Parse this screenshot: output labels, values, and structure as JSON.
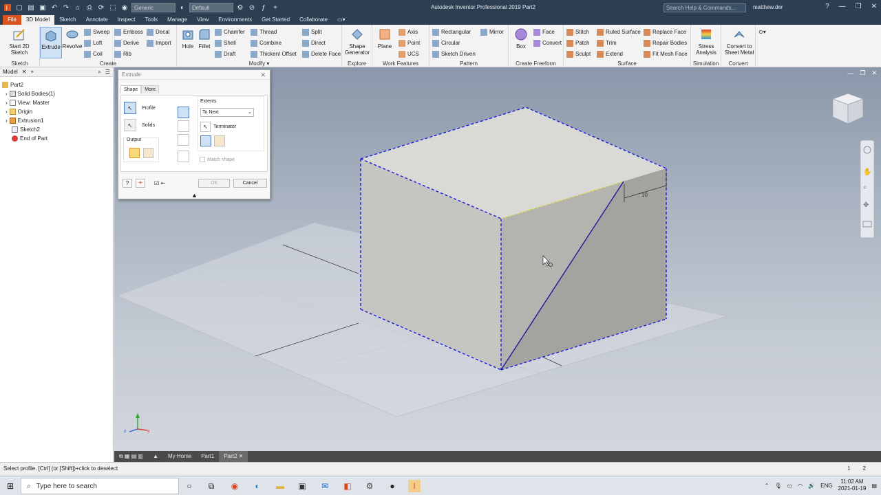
{
  "titlebar": {
    "app_title": "Autodesk Inventor Professional 2019    Part2",
    "material": "Generic",
    "appearance": "Default",
    "search_placeholder": "Search Help & Commands...",
    "user": "matthew.der"
  },
  "ribbon_tabs": [
    "File",
    "3D Model",
    "Sketch",
    "Annotate",
    "Inspect",
    "Tools",
    "Manage",
    "View",
    "Environments",
    "Get Started",
    "Collaborate"
  ],
  "ribbon": {
    "sketch": {
      "title": "Sketch",
      "start_sketch": "Start 2D Sketch"
    },
    "create": {
      "title": "Create",
      "extrude": "Extrude",
      "revolve": "Revolve",
      "sweep": "Sweep",
      "emboss": "Emboss",
      "decal": "Decal",
      "loft": "Loft",
      "derive": "Derive",
      "import": "Import",
      "coil": "Coil",
      "rib": "Rib"
    },
    "modify": {
      "title": "Modify",
      "hole": "Hole",
      "fillet": "Fillet",
      "chamfer": "Chamfer",
      "thread": "Thread",
      "split": "Split",
      "shell": "Shell",
      "combine": "Combine",
      "direct": "Direct",
      "draft": "Draft",
      "thicken": "Thicken/ Offset",
      "delete_face": "Delete Face"
    },
    "explore": {
      "title": "Explore",
      "shape_generator": "Shape Generator"
    },
    "work_features": {
      "title": "Work Features",
      "plane": "Plane",
      "axis": "Axis",
      "point": "Point",
      "ucs": "UCS"
    },
    "pattern": {
      "title": "Pattern",
      "rectangular": "Rectangular",
      "mirror": "Mirror",
      "circular": "Circular",
      "sketch_driven": "Sketch Driven"
    },
    "create_freeform": {
      "title": "Create Freeform",
      "box": "Box",
      "face": "Face",
      "convert": "Convert"
    },
    "surface": {
      "title": "Surface",
      "stitch": "Stitch",
      "ruled_surface": "Ruled Surface",
      "replace_face": "Replace Face",
      "patch": "Patch",
      "trim": "Trim",
      "repair_bodies": "Repair Bodies",
      "sculpt": "Sculpt",
      "extend": "Extend",
      "fit_mesh_face": "Fit Mesh Face"
    },
    "simulation": {
      "title": "Simulation",
      "stress_analysis": "Stress Analysis"
    },
    "convert": {
      "title": "Convert",
      "convert_sheet_metal": "Convert to Sheet Metal"
    }
  },
  "browser": {
    "tab": "Model",
    "items": [
      "Part2",
      "Solid Bodies(1)",
      "View: Master",
      "Origin",
      "Extrusion1",
      "Sketch2",
      "End of Part"
    ]
  },
  "dialog": {
    "title": "Extrude",
    "tabs": [
      "Shape",
      "More"
    ],
    "profile": "Profile",
    "solids": "Solids",
    "output": "Output",
    "extents_label": "Extents",
    "extents_value": "To Next",
    "terminator": "Terminator",
    "match_shape": "Match shape",
    "ok": "OK",
    "cancel": "Cancel"
  },
  "viewport": {
    "dimension": "10"
  },
  "doc_tabs": [
    "My Home",
    "Part1",
    "Part2"
  ],
  "status": {
    "message": "Select profile. [Ctrl] (or [Shift])+click to deselect",
    "num1": "1",
    "num2": "2"
  },
  "taskbar": {
    "search_placeholder": "Type here to search",
    "lang": "ENG",
    "time": "11:02 AM",
    "date": "2021-01-19"
  },
  "colors": {
    "titlebar": "#2b3e52",
    "file_tab": "#d9531e",
    "selection": "#1a1adb"
  }
}
